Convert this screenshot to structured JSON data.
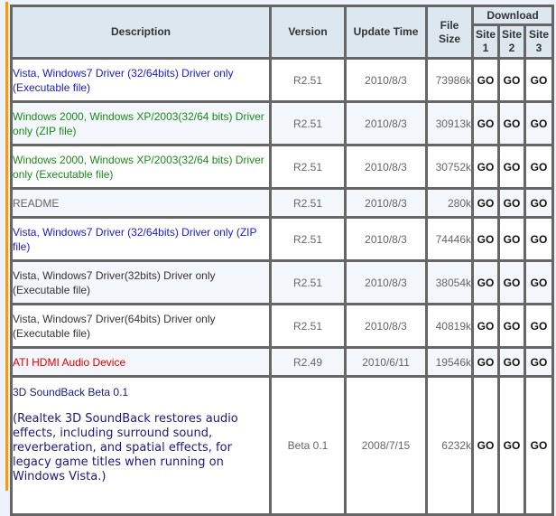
{
  "accent_color": "#ff9900",
  "table": {
    "headers": {
      "description": "Description",
      "version": "Version",
      "update_time": "Update Time",
      "file_size": "File Size",
      "download": "Download",
      "site1": "Site 1",
      "site2": "Site 2",
      "site3": "Site 3"
    },
    "rows": [
      {
        "description": "Vista, Windows7 Driver (32/64bits) Driver only (Executable file)",
        "color": "blue",
        "version": "R2.51",
        "update_time": "2010/8/3",
        "file_size": "73986k",
        "site1": "GO",
        "site2": "GO",
        "site3": "GO"
      },
      {
        "description": "Windows 2000, Windows XP/2003(32/64 bits) Driver only (ZIP file)",
        "color": "green",
        "version": "R2.51",
        "update_time": "2010/8/3",
        "file_size": "30913k",
        "site1": "GO",
        "site2": "GO",
        "site3": "GO"
      },
      {
        "description": "Windows 2000, Windows XP/2003(32/64 bits) Driver only (Executable file)",
        "color": "green",
        "version": "R2.51",
        "update_time": "2010/8/3",
        "file_size": "30752k",
        "site1": "GO",
        "site2": "GO",
        "site3": "GO"
      },
      {
        "description": "README",
        "color": "gray",
        "version": "R2.51",
        "update_time": "2010/8/3",
        "file_size": "280k",
        "site1": "GO",
        "site2": "GO",
        "site3": "GO"
      },
      {
        "description": "Vista, Windows7 Driver (32/64bits) Driver only (ZIP file)",
        "color": "blue",
        "version": "R2.51",
        "update_time": "2010/8/3",
        "file_size": "74446k",
        "site1": "GO",
        "site2": "GO",
        "site3": "GO"
      },
      {
        "description": "Vista, Windows7 Driver(32bits) Driver only (Executable file)",
        "color": "black",
        "version": "R2.51",
        "update_time": "2010/8/3",
        "file_size": "38054k",
        "site1": "GO",
        "site2": "GO",
        "site3": "GO"
      },
      {
        "description": "Vista, Windows7 Driver(64bits) Driver only (Executable file)",
        "color": "black",
        "version": "R2.51",
        "update_time": "2010/8/3",
        "file_size": "40819k",
        "site1": "GO",
        "site2": "GO",
        "site3": "GO"
      },
      {
        "description": "ATI HDMI Audio Device",
        "color": "red",
        "version": "R2.49",
        "update_time": "2010/6/11",
        "file_size": "19546k",
        "site1": "GO",
        "site2": "GO",
        "site3": "GO"
      },
      {
        "description": "3D SoundBack Beta 0.1",
        "note": "(Realtek 3D SoundBack restores audio effects, including surround sound, reverberation, and spatial effects, for legacy game titles when running on Windows Vista.)",
        "color": "navy",
        "version": "Beta 0.1",
        "update_time": "2008/7/15",
        "file_size": "6232k",
        "site1": "GO",
        "site2": "GO",
        "site3": "GO"
      }
    ]
  }
}
